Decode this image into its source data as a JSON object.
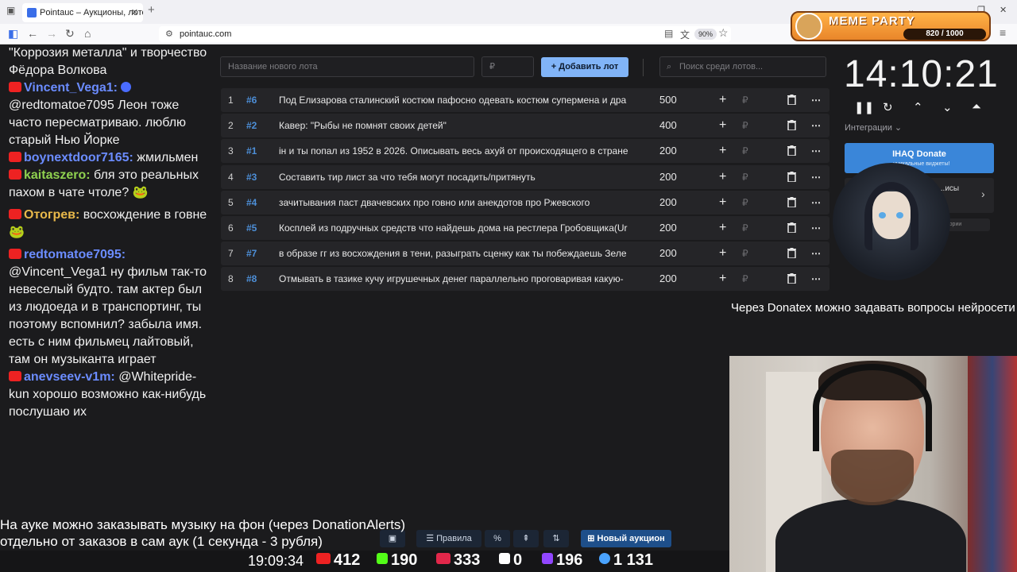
{
  "browser": {
    "tab_title": "Pointauc – Аукционы, лотереи",
    "url": "pointauc.com",
    "zoom": "90%"
  },
  "meme_party": {
    "title": "MEME PARTY",
    "progress": "820 / 1000"
  },
  "chat": {
    "messages": [
      {
        "user": "",
        "text": "\"Коррозия металла\" и творчество Фёдора Волкова",
        "color": "#ffffff"
      },
      {
        "user": "Vincent_Vega1:",
        "text": "@redtomatoe7095 Леон тоже часто пересматриваю. люблю старый Нью Йорке",
        "color": "#6b8cff"
      },
      {
        "user": "boynextdoor7165:",
        "text": "жмильмен",
        "color": "#6b8cff"
      },
      {
        "user": "kaitaszero:",
        "text": "бля это реальных пахом в чате чтоле?",
        "color": "#8fd14f"
      },
      {
        "user": "Отогрев:",
        "text": "восхождение в говне",
        "color": "#e8b84a"
      },
      {
        "user": "redtomatoe7095:",
        "text": "@Vincent_Vega1 ну фильм так-то невеселый будто. там актер был из людоеда и в транспортинг, ты поэтому вспомнил? забыла имя. есть с ним фильмец лайтовый, там он музыканта играет",
        "color": "#6b8cff"
      },
      {
        "user": "anevseev-v1m:",
        "text": "@Whitepride-kun хорошо возможно как-нибудь послушаю их",
        "color": "#6b8cff"
      }
    ]
  },
  "controls": {
    "lot_name_placeholder": "Название нового лота",
    "amount_placeholder": "₽",
    "add_lot_label": "Добавить лот",
    "search_placeholder": "Поиск среди лотов..."
  },
  "lots": [
    {
      "index": "1",
      "num": "#6",
      "name": "Под Елизарова сталинский костюм пафосно одевать костюм супермена и дра",
      "amount": "500"
    },
    {
      "index": "2",
      "num": "#2",
      "name": "Кавер: \"Рыбы не помнят своих детей\"",
      "amount": "400"
    },
    {
      "index": "3",
      "num": "#1",
      "name": "ін и ты попал из 1952 в 2026. Описывать весь ахуй от происходящего в стране",
      "amount": "200"
    },
    {
      "index": "4",
      "num": "#3",
      "name": "Составить тир лист за что тебя могут посадить/притянуть",
      "amount": "200"
    },
    {
      "index": "5",
      "num": "#4",
      "name": "зачитывания паст двачевских про говно или анекдотов про Ржевского",
      "amount": "200"
    },
    {
      "index": "6",
      "num": "#5",
      "name": "Косплей из подручных средств что найдешь дома на рестлера Гробовщика(Ur",
      "amount": "200"
    },
    {
      "index": "7",
      "num": "#7",
      "name": "в образе гг из восхождения в тени, разыграть сценку как ты побеждаешь Зеле",
      "amount": "200"
    },
    {
      "index": "8",
      "num": "#8",
      "name": "Отмывать в тазике кучу игрушечных денег параллельно проговаривая какую-",
      "amount": "200"
    }
  ],
  "timer": {
    "time": "14:10:21"
  },
  "integrations": {
    "label": "Интеграции",
    "donate_title": "IHAQ Donate",
    "donate_sub": "...уникальные виджеты!",
    "card2_label": "...исы",
    "card3_label": "...тории"
  },
  "notice": "Через Donatex можно задавать вопросы нейросети",
  "overlay": {
    "line1": "На ауке можно заказывать музыку на фон (через DonationAlerts)",
    "line2": "отдельно от заказов в сам аук (1 секунда - 3 рубля)"
  },
  "bottom_tools": {
    "rules_label": "Правила",
    "new_auction_label": "Новый аукцион"
  },
  "stats": {
    "time": "19:09:34",
    "youtube": "412",
    "kick": "190",
    "vk": "333",
    "rutube": "0",
    "twitch": "196",
    "total": "1 131"
  }
}
